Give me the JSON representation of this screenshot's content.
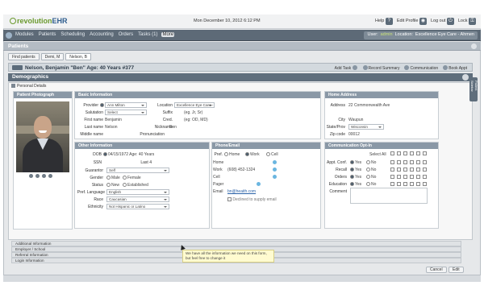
{
  "app": {
    "logo_prefix": "revolution",
    "logo_suffix": "EHR",
    "datetime": "Mon December 10, 2012  6:12 PM"
  },
  "topbar_right": [
    "Help",
    "Edit Profile",
    "Log out",
    "Lock"
  ],
  "nav": {
    "items": [
      "Modules",
      "Patients",
      "Scheduling",
      "Accounting",
      "Orders",
      "Tasks (1)"
    ],
    "more": "More",
    "user_label": "User:",
    "user_value": "admin",
    "location_label": "Location:",
    "location_value": "Excellence Eye Care - Ahmen"
  },
  "section_title": "Patients",
  "tabs": [
    "Find patients",
    "Demi, M",
    "Nelson, B"
  ],
  "patient": {
    "name": "Nelson, Benjamin \"Ben\"  Age: 40 Years  #377",
    "actions": [
      "Add Task",
      "Record Summary",
      "Communication",
      "Book Appt"
    ]
  },
  "demographics_title": "Demographics",
  "sub_header": "Personal Details",
  "photo_panel": {
    "title": "Patient Photograph"
  },
  "basic": {
    "title": "Basic Information",
    "provider_label": "Provider",
    "provider_value": "Ann Milton",
    "location_label": "Location",
    "location_value": "Excellence Eye Care - H",
    "salutation_label": "Salutation",
    "salutation_value": "Select",
    "suffix_label": "Suffix",
    "suffix_value": "(eg. Jr, Sr)",
    "first_label": "First name",
    "first_value": "Benjamin",
    "cred_label": "Cred.",
    "cred_value": "(eg: OD, MD)",
    "last_label": "Last name",
    "last_value": "Nelson",
    "nickname_label": "Nickname",
    "nickname_value": "Ben",
    "middle_label": "Middle name",
    "pronunciation_label": "Pronunciation"
  },
  "other": {
    "title": "Other Information",
    "dob_label": "DOB",
    "dob_value": "04/15/1972  Age: 40 Years",
    "ssn_label": "SSN",
    "last4_label": "Last 4",
    "guarantor_label": "Guarantor",
    "guarantor_value": "Self",
    "gender_label": "Gender",
    "gender_opt1": "Male",
    "gender_opt2": "Female",
    "status_label": "Status",
    "status_opt1": "New",
    "status_opt2": "Established",
    "lang_label": "Pref. Language",
    "lang_value": "English",
    "race_label": "Race",
    "race_value": "Caucasian",
    "ethnicity_label": "Ethnicity",
    "ethnicity_value": "Not Hispanic or Latino"
  },
  "phone": {
    "title": "Phone/Email",
    "pref_label": "Pref.",
    "pref_opt1": "Home",
    "pref_opt2": "Work",
    "pref_opt3": "Cell",
    "home_label": "Home",
    "work_label": "Work",
    "work_value": "(608) 452-1324",
    "cell_label": "Cell",
    "pager_label": "Pager",
    "email_label": "Email",
    "email_value": "bn@heaith.com",
    "declined_label": "Declined to supply email"
  },
  "address": {
    "title": "Home Address",
    "address_label": "Address",
    "address_value": "22 Commonwealth Ave",
    "city_label": "City",
    "city_value": "Waupun",
    "state_label": "State/Prov",
    "state_value": "Wisconsin",
    "zip_label": "Zip code",
    "zip_value": "00012"
  },
  "comm": {
    "title": "Communication Opt-In",
    "select_all": "Select All",
    "rows": [
      {
        "label": "Appt. Conf.",
        "yes": "Yes",
        "no": "No"
      },
      {
        "label": "Recall",
        "yes": "Yes",
        "no": "No"
      },
      {
        "label": "Orders",
        "yes": "Yes",
        "no": "No"
      },
      {
        "label": "Education",
        "yes": "Yes",
        "no": "No"
      }
    ],
    "comment_label": "Comment"
  },
  "collapsed": [
    "Additional Information",
    "Employer / School",
    "Referral Information",
    "Login Information"
  ],
  "tooltip": "We have all the information we need on this form, but feel free to change it",
  "buttons": {
    "cancel": "Cancel",
    "edit": "Edit"
  },
  "side_tab": "Patient Sidebar"
}
